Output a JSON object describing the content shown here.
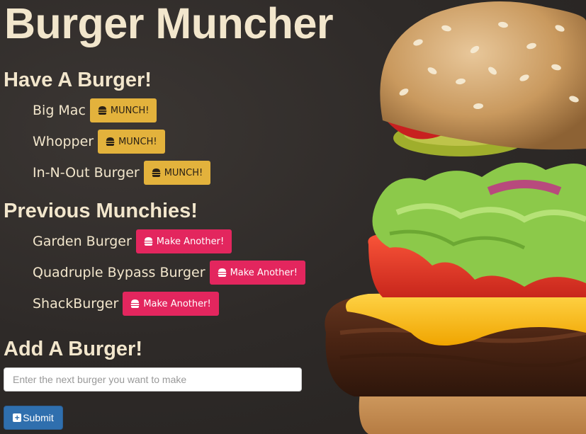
{
  "app": {
    "title": "Burger Muncher"
  },
  "colors": {
    "heading_text": "#f2e6cc",
    "munch_button": "#e3b23c",
    "make_another_button": "#e3265e",
    "submit_button": "#2f6fae",
    "background": "#2e2a28"
  },
  "have_section": {
    "heading": "Have A Burger!",
    "items": [
      {
        "name": "Big Mac",
        "button_label": "MUNCH!",
        "button_icon": "burger-icon"
      },
      {
        "name": "Whopper",
        "button_label": "MUNCH!",
        "button_icon": "burger-icon"
      },
      {
        "name": "In-N-Out Burger",
        "button_label": "MUNCH!",
        "button_icon": "burger-icon"
      }
    ]
  },
  "previous_section": {
    "heading": "Previous Munchies!",
    "items": [
      {
        "name": "Garden Burger",
        "button_label": "Make Another!",
        "button_icon": "burger-icon"
      },
      {
        "name": "Quadruple Bypass Burger",
        "button_label": "Make Another!",
        "button_icon": "burger-icon"
      },
      {
        "name": "ShackBurger",
        "button_label": "Make Another!",
        "button_icon": "burger-icon"
      }
    ]
  },
  "add_section": {
    "heading": "Add A Burger!",
    "input_placeholder": "Enter the next burger you want to make",
    "input_value": "",
    "submit_label": "Submit",
    "submit_icon": "plus-square-icon"
  }
}
